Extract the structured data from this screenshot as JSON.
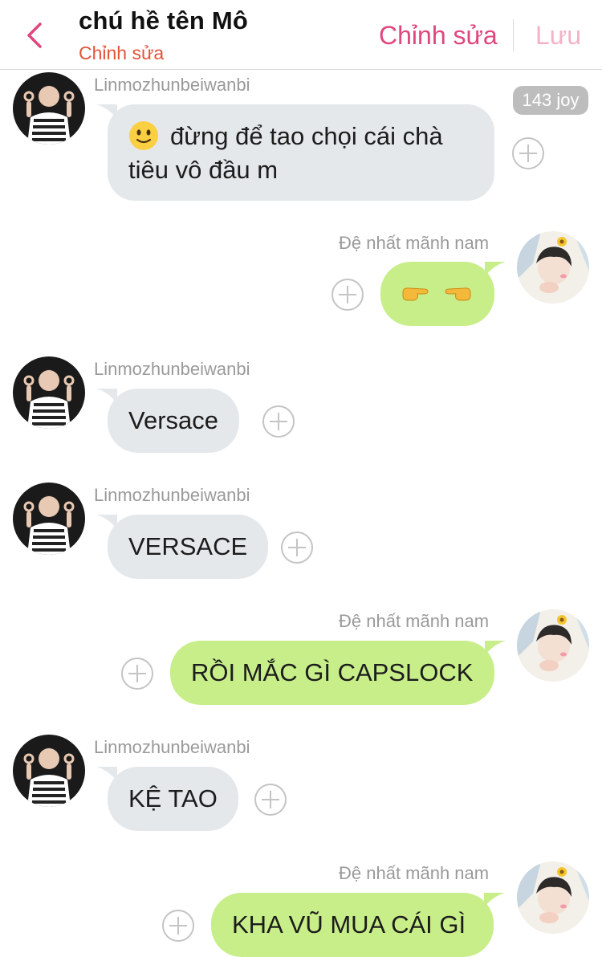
{
  "header": {
    "title": "chú hề tên Mô",
    "subtitle": "Chỉnh sửa",
    "edit_label": "Chỉnh sửa",
    "save_label": "Lưu",
    "accent_color": "#e0477e"
  },
  "messages": [
    {
      "side": "left",
      "sender": "Linmozhunbeiwanbi",
      "line1": "đừng để tao chọi cái chà",
      "line2": "tiêu vô đầu m",
      "leading_icon": "slightly-smiling-face-icon",
      "reactions": "143 joy"
    },
    {
      "side": "right",
      "sender": "Đệ nhất mãnh nam",
      "icons": [
        "pointing-right-icon",
        "pointing-left-icon"
      ]
    },
    {
      "side": "left",
      "sender": "Linmozhunbeiwanbi",
      "text": "Versace"
    },
    {
      "side": "left",
      "sender": "Linmozhunbeiwanbi",
      "text": "VERSACE"
    },
    {
      "side": "right",
      "sender": "Đệ nhất mãnh nam",
      "text": "RỒI MẮC GÌ CAPSLOCK"
    },
    {
      "side": "left",
      "sender": "Linmozhunbeiwanbi",
      "text": "KỆ TAO"
    },
    {
      "side": "right",
      "sender": "Đệ nhất mãnh nam",
      "text": "KHA VŨ MUA CÁI GÌ"
    }
  ],
  "colors": {
    "left_bubble": "#e4e8eb",
    "right_bubble": "#c8ee8a",
    "subtitle": "#e2543a",
    "save_disabled": "#f2b3c9"
  }
}
